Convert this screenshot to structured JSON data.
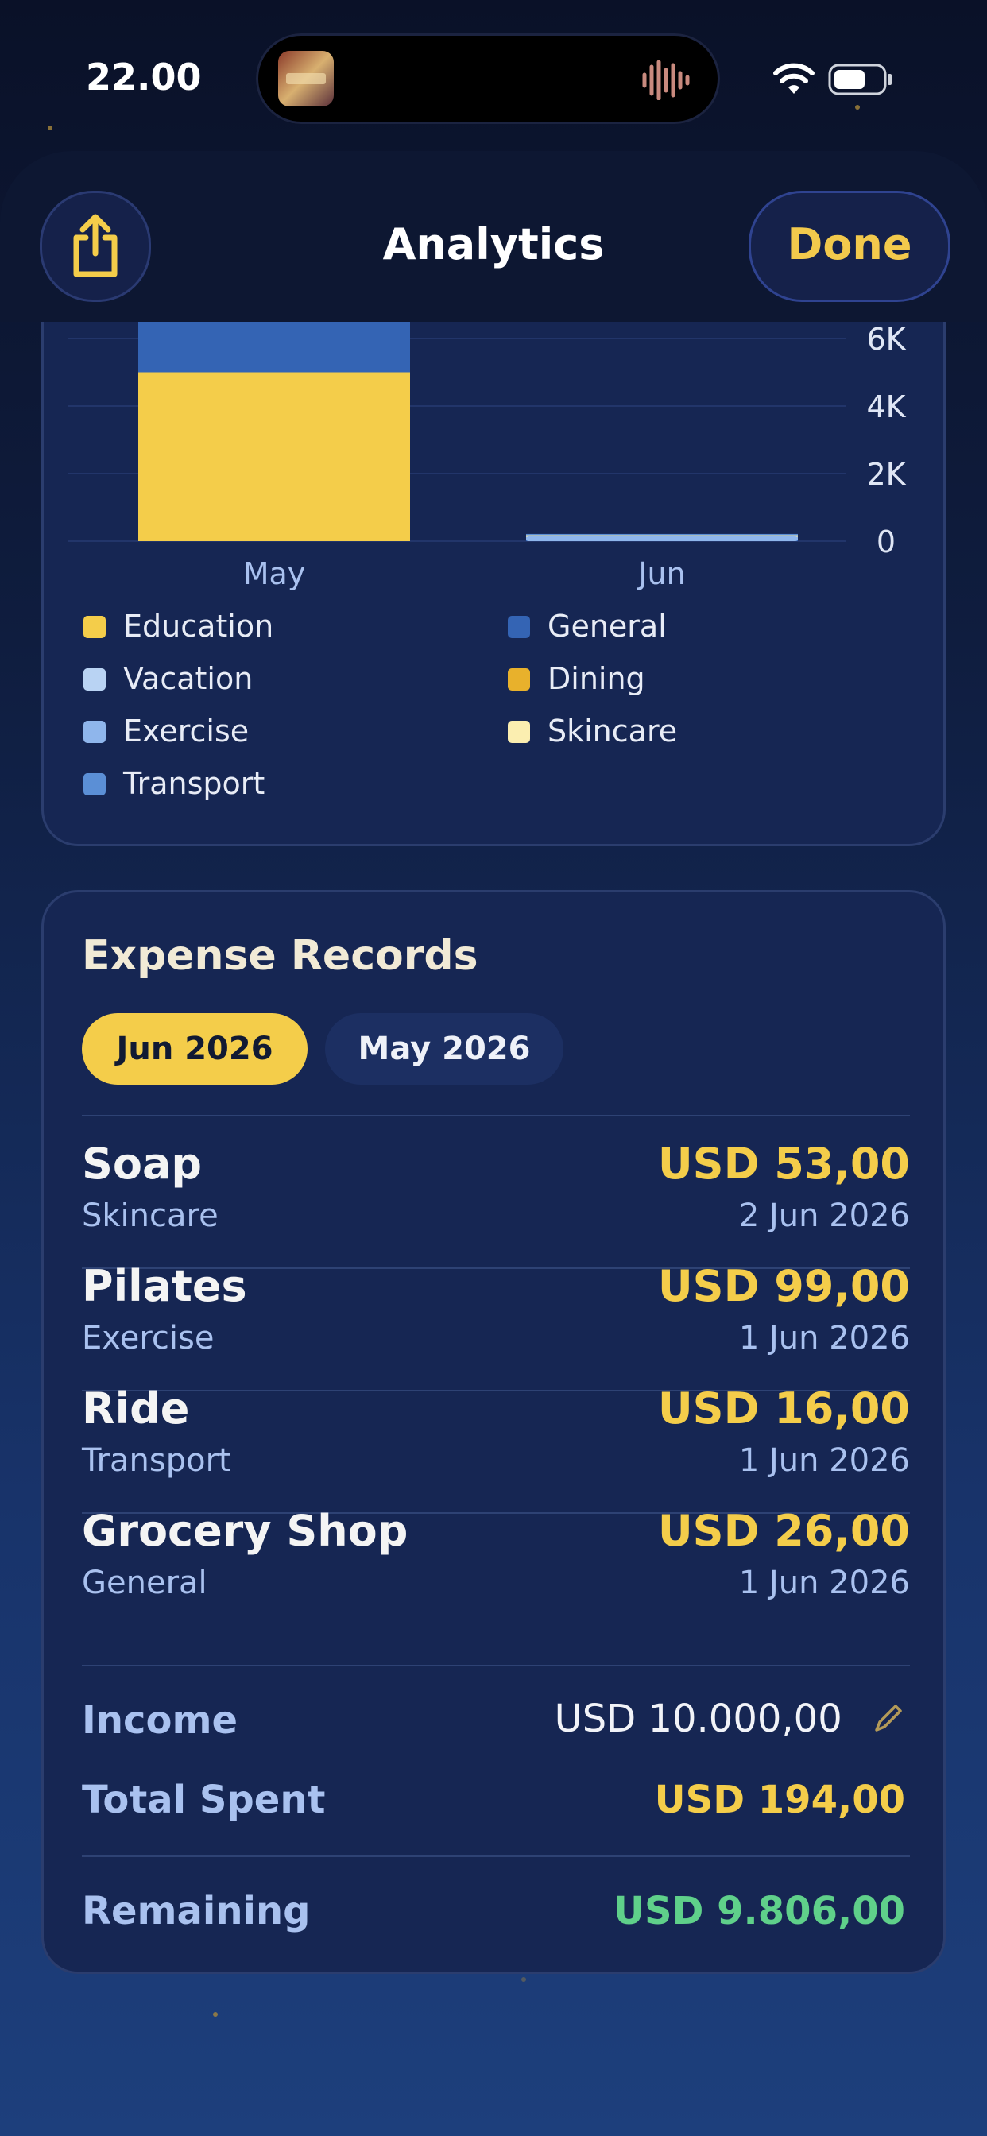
{
  "status_bar": {
    "time": "22.00"
  },
  "header": {
    "title": "Analytics",
    "done_label": "Done"
  },
  "chart_data": {
    "type": "bar",
    "stacked": true,
    "categories": [
      "May",
      "Jun"
    ],
    "y_ticks": [
      "0",
      "2K",
      "4K",
      "6K"
    ],
    "ylim": [
      0,
      6000
    ],
    "series": [
      {
        "name": "Education",
        "color": "#f4cd4a",
        "values": [
          5000,
          0
        ]
      },
      {
        "name": "General",
        "color": "#3464b4",
        "values": [
          1500,
          26
        ]
      },
      {
        "name": "Vacation",
        "color": "#b9d3f3",
        "values": [
          0,
          0
        ]
      },
      {
        "name": "Dining",
        "color": "#e8b12c",
        "values": [
          0,
          0
        ]
      },
      {
        "name": "Exercise",
        "color": "#8fb6ec",
        "values": [
          0,
          99
        ]
      },
      {
        "name": "Skincare",
        "color": "#fbeeb0",
        "values": [
          0,
          53
        ]
      },
      {
        "name": "Transport",
        "color": "#5b8fd6",
        "values": [
          0,
          16
        ]
      }
    ]
  },
  "records": {
    "title": "Expense Records",
    "tabs": [
      "Jun 2026",
      "May 2026"
    ],
    "items": [
      {
        "name": "Soap",
        "category": "Skincare",
        "amount": "USD 53,00",
        "date": "2 Jun 2026"
      },
      {
        "name": "Pilates",
        "category": "Exercise",
        "amount": "USD 99,00",
        "date": "1 Jun 2026"
      },
      {
        "name": "Ride",
        "category": "Transport",
        "amount": "USD 16,00",
        "date": "1 Jun 2026"
      },
      {
        "name": "Grocery Shop",
        "category": "General",
        "amount": "USD 26,00",
        "date": "1 Jun 2026"
      }
    ],
    "summary": {
      "income_label": "Income",
      "income_value": "USD 10.000,00",
      "spent_label": "Total Spent",
      "spent_value": "USD 194,00",
      "remaining_label": "Remaining",
      "remaining_value": "USD 9.806,00"
    }
  }
}
